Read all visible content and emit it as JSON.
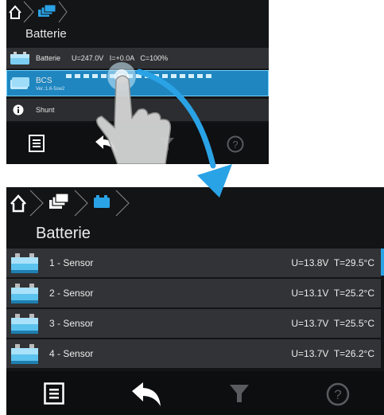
{
  "panel_small": {
    "title": "Batterie",
    "rows": [
      {
        "label": "Batterie",
        "values": "U=247.0V   I=+0.0A   C=100%"
      },
      {
        "label": "BCS",
        "sublabel": "Ver.:1.6-5sw2"
      },
      {
        "label": "Shunt"
      }
    ],
    "footer": {
      "list": "list-icon",
      "back": "back-arrow-icon",
      "filter": "filter-icon",
      "help": "help-icon"
    }
  },
  "panel_large": {
    "title": "Batterie",
    "rows": [
      {
        "label": "1 - Sensor",
        "values": "U=13.8V  T=29.5°C"
      },
      {
        "label": "2 - Sensor",
        "values": "U=13.1V  T=25.2°C"
      },
      {
        "label": "3 - Sensor",
        "values": "U=13.7V  T=25.5°C"
      },
      {
        "label": "4 - Sensor",
        "values": "U=13.7V  T=26.2°C"
      }
    ],
    "footer": {
      "list": "list-icon",
      "back": "back-arrow-icon",
      "filter": "filter-icon",
      "help": "help-icon"
    }
  },
  "colors": {
    "accent": "#2aa3e6",
    "highlight": "#1f86bf",
    "row": "#323336",
    "background": "#131416"
  }
}
